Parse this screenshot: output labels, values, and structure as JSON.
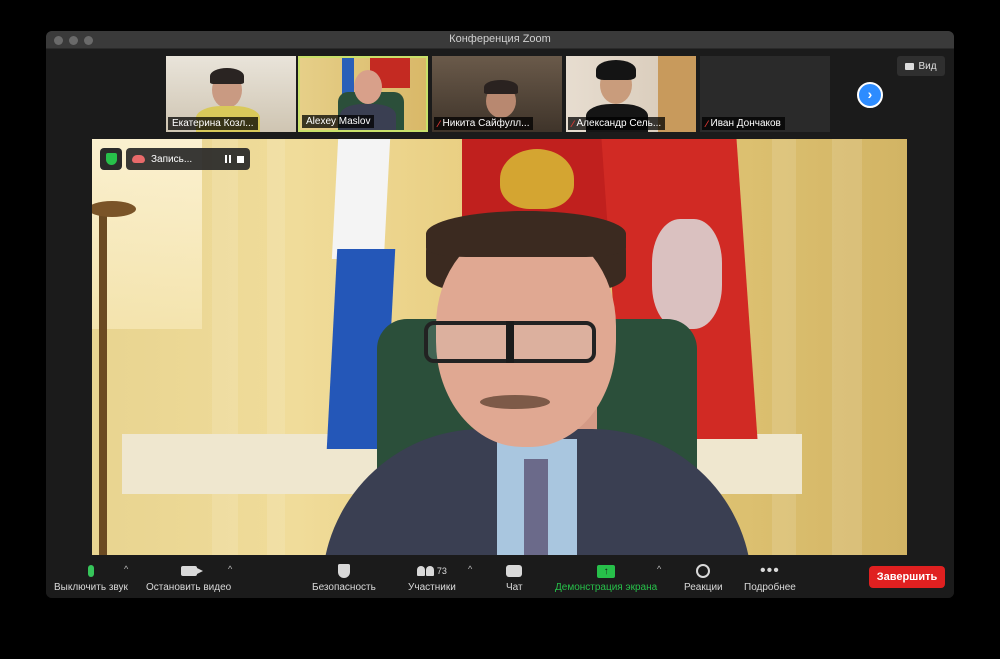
{
  "window": {
    "title": "Конференция Zoom"
  },
  "thumbnails": [
    {
      "name": "Екатерина Козл...",
      "muted": false,
      "active": false
    },
    {
      "name": "Alexey Maslov",
      "muted": false,
      "active": true
    },
    {
      "name": "Никита Сайфулл...",
      "muted": true,
      "active": false
    },
    {
      "name": "Александр Сель...",
      "muted": true,
      "active": false
    },
    {
      "name": "Иван Дончаков",
      "muted": true,
      "active": false
    }
  ],
  "view_button": {
    "label": "Вид"
  },
  "next_button": {
    "glyph": "›"
  },
  "recording": {
    "label": "Запись..."
  },
  "toolbar": {
    "mute_label": "Выключить звук",
    "video_label": "Остановить видео",
    "security_label": "Безопасность",
    "participants_label": "Участники",
    "participants_count": "73",
    "chat_label": "Чат",
    "share_label": "Демонстрация экрана",
    "reactions_label": "Реакции",
    "more_label": "Подробнее",
    "end_label": "Завершить",
    "caret": "^",
    "more_glyph": "•••",
    "share_glyph": "↑",
    "mic_off_glyph": "⁄"
  },
  "colors": {
    "accent_blue": "#2d8cff",
    "share_green": "#27c04a",
    "end_red": "#e02020",
    "active_border": "#c9e06a",
    "muted_red": "#e53935"
  }
}
